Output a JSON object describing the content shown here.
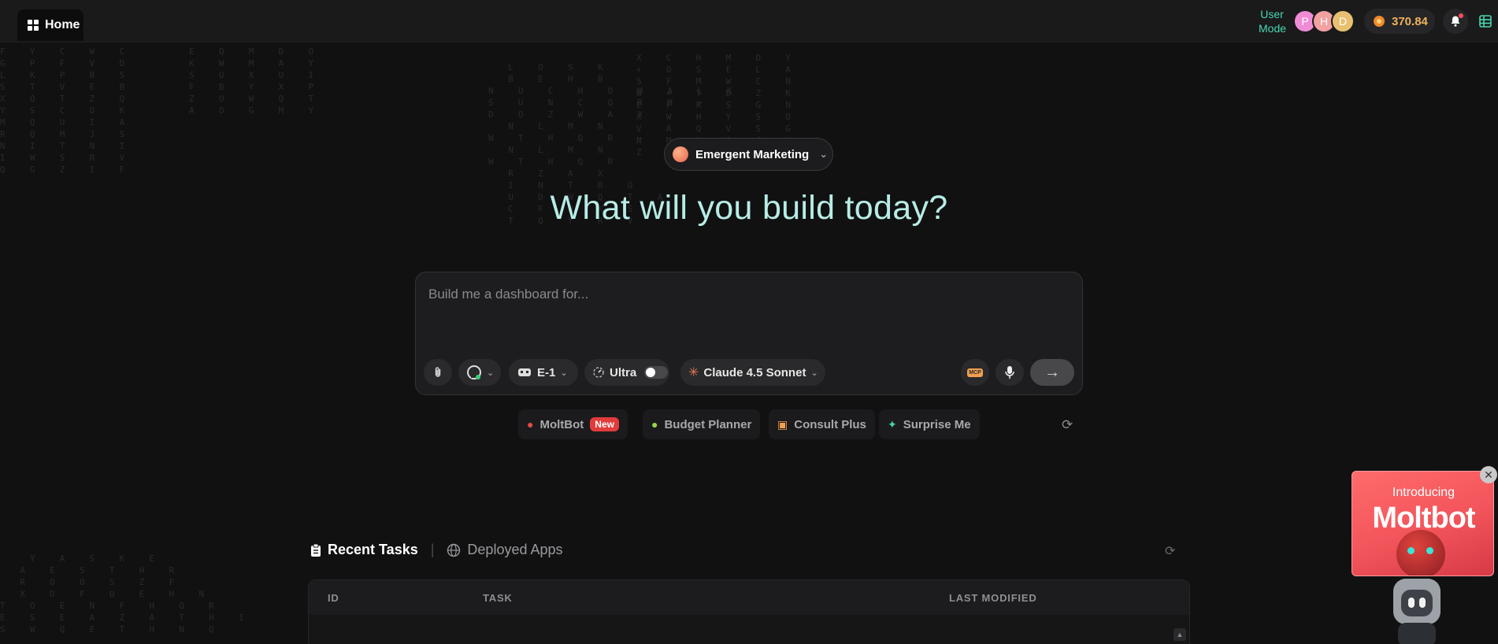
{
  "topbar": {
    "home_tab": "Home",
    "user_mode": "User Mode",
    "avatars": [
      {
        "initial": "P",
        "color": "#f08bd6"
      },
      {
        "initial": "H",
        "color": "#f2a0a0"
      },
      {
        "initial": "D",
        "color": "#e8c070"
      }
    ],
    "credits": "370.84",
    "icons": {
      "home": "grid-icon",
      "credits": "coin-icon",
      "notifications": "bell-icon",
      "table": "table-icon"
    }
  },
  "workspace": {
    "label": "Emergent Marketing"
  },
  "headline": "What will you build today?",
  "prompt": {
    "placeholder": "Build me a dashboard for...",
    "agent": "E-1",
    "mode": "Ultra",
    "model": "Claude 4.5 Sonnet",
    "mcp_label": "MCP"
  },
  "suggestions": [
    {
      "label": "MoltBot",
      "badge": "New",
      "icon": "moltbot-icon"
    },
    {
      "label": "Budget Planner",
      "icon": "piggy-bank-icon"
    },
    {
      "label": "Consult Plus",
      "icon": "window-icon"
    },
    {
      "label": "Surprise Me",
      "icon": "sparkle-icon"
    }
  ],
  "tasks": {
    "tab_recent": "Recent Tasks",
    "tab_deployed": "Deployed Apps",
    "columns": [
      "ID",
      "TASK",
      "LAST MODIFIED"
    ]
  },
  "promo": {
    "intro": "Introducing",
    "title": "Moltbot"
  }
}
